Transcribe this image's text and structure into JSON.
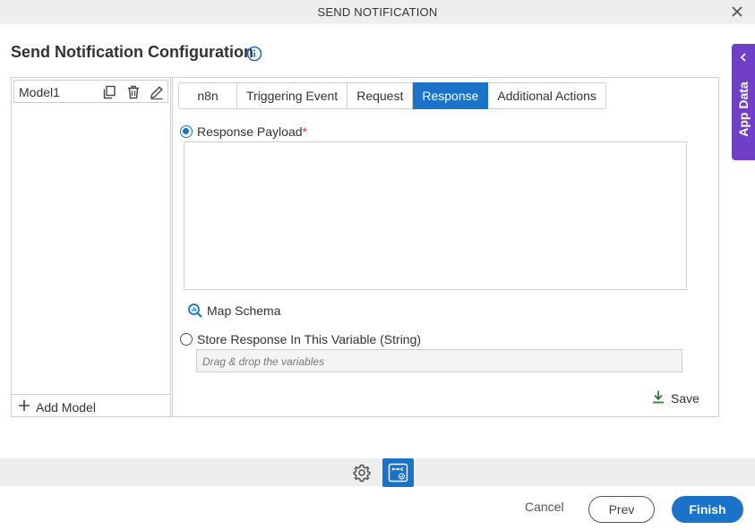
{
  "dialog": {
    "title": "SEND NOTIFICATION",
    "heading": "Send Notification Configuration"
  },
  "app_data": {
    "label": "App Data"
  },
  "models": {
    "items": [
      {
        "name": "Model1"
      }
    ],
    "add_label": "Add Model"
  },
  "tabs": [
    {
      "label": "n8n"
    },
    {
      "label": "Triggering Event"
    },
    {
      "label": "Request"
    },
    {
      "label": "Response",
      "active": true
    },
    {
      "label": "Additional Actions"
    }
  ],
  "response": {
    "payload_label": "Response Payload",
    "required_mark": "*",
    "payload_value": "",
    "map_schema_label": "Map Schema",
    "store_label": "Store Response In This Variable (String)",
    "variable_placeholder": "Drag & drop the variables",
    "save_label": "Save"
  },
  "footer": {
    "cancel_label": "Cancel",
    "prev_label": "Prev",
    "finish_label": "Finish"
  },
  "colors": {
    "accent": "#1a73c8",
    "app_data_tab": "#6f3fc9",
    "save_icon": "#2e7d32",
    "required": "#d9302c"
  }
}
